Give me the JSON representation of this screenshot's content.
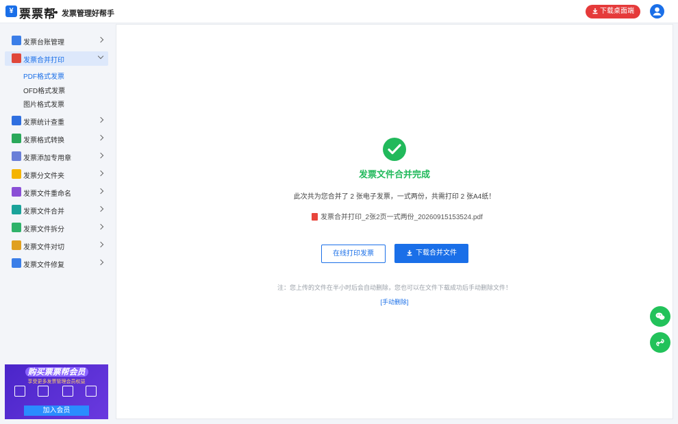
{
  "header": {
    "brand": "票票帮",
    "tagline": "发票管理好帮手",
    "download_label": "下载桌面端"
  },
  "sidebar": {
    "items": [
      {
        "label": "发票台账管理",
        "icon": "ledger-icon",
        "color": "#3b7ee8"
      },
      {
        "label": "发票合并打印",
        "icon": "printer-icon",
        "color": "#e0473a",
        "expanded": true,
        "children": [
          {
            "label": "PDF格式发票",
            "active": true
          },
          {
            "label": "OFD格式发票"
          },
          {
            "label": "图片格式发票"
          }
        ]
      },
      {
        "label": "发票统计查重",
        "icon": "stats-icon",
        "color": "#2f6fe0"
      },
      {
        "label": "发票格式转换",
        "icon": "convert-icon",
        "color": "#2aa85a"
      },
      {
        "label": "发票添加专用章",
        "icon": "seal-icon",
        "color": "#6a7fd8"
      },
      {
        "label": "发票分文件夹",
        "icon": "folder-icon",
        "color": "#f4b400"
      },
      {
        "label": "发票文件重命名",
        "icon": "rename-icon",
        "color": "#8a4fd6"
      },
      {
        "label": "发票文件合并",
        "icon": "merge-icon",
        "color": "#1aa39a"
      },
      {
        "label": "发票文件拆分",
        "icon": "split-icon",
        "color": "#2fb26a"
      },
      {
        "label": "发票文件对切",
        "icon": "cut-icon",
        "color": "#e0a020"
      },
      {
        "label": "发票文件修复",
        "icon": "wrench-icon",
        "color": "#3b7ee8"
      }
    ],
    "promo": {
      "title": "购买票票帮会员",
      "subtitle": "享受更多发票管理会员权益",
      "button": "加入会员"
    }
  },
  "main": {
    "done_title": "发票文件合并完成",
    "summary": "此次共为您合并了 2 张电子发票，一式两份，共需打印 2 张A4纸！",
    "file_name": "发票合并打印_2张2页一式两份_20260915153524.pdf",
    "print_online": "在线打印发票",
    "download_merged": "下载合并文件",
    "note": "注：您上传的文件在半小时后会自动删除，您也可以在文件下载成功后手动删除文件！",
    "manual_delete": "[手动删除]"
  },
  "colors": {
    "accent": "#1a6fe8",
    "success": "#21b95b",
    "danger": "#e53a3a"
  }
}
